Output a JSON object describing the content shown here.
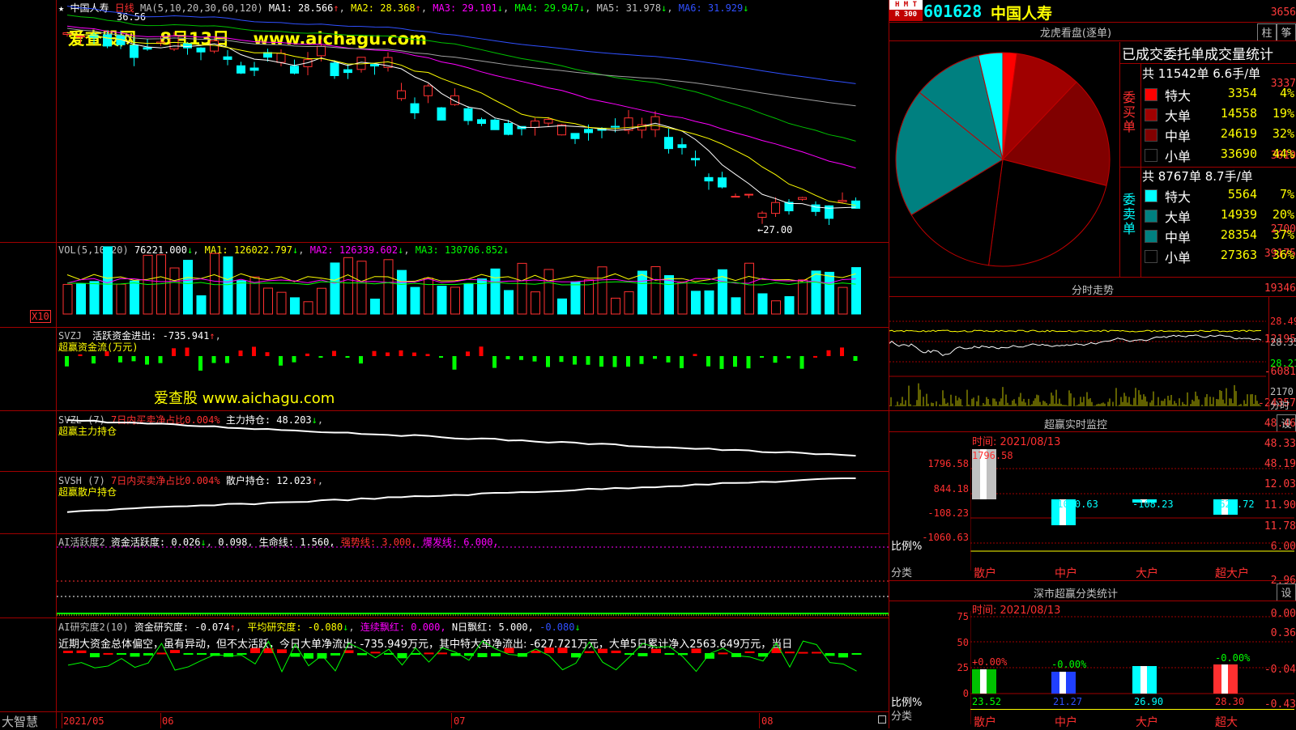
{
  "stock": {
    "code": "601628",
    "name": "中国人寿",
    "tag_lines": [
      "H M T",
      "R 300"
    ]
  },
  "watermark": {
    "site_name": "爱查股网",
    "date": "8月13日",
    "url": "www.aichagu.com",
    "sub": "爱查股 www.aichagu.com"
  },
  "main_chart": {
    "title_star": "★",
    "name": "中国人寿",
    "period": "日线",
    "ma_label": "MA(5,10,20,30,60,120)",
    "ma1": "MA1: 28.566",
    "ma2": "MA2: 28.368",
    "ma3": "MA3: 29.101",
    "ma4": "MA4: 29.947",
    "ma5": "MA5: 31.978",
    "ma6": "MA6: 31.929",
    "y_ticks": [
      "3656",
      "3337",
      "3019",
      "2700"
    ],
    "high_mark": "36.56",
    "low_mark": "←27.00",
    "chart_data": {
      "type": "line",
      "title": "中国人寿 日线",
      "y_ticks": [
        36.56,
        33.37,
        30.19,
        27.0
      ],
      "note": "candlestick price chart with moving averages"
    }
  },
  "vol_panel": {
    "label": "VOL(5,10,20)",
    "value": "76221.000",
    "ma1": "MA1: 126022.797",
    "ma2": "MA2: 126339.602",
    "ma3": "MA3: 130706.852",
    "y_ticks": [
      "39175",
      "19346"
    ],
    "unit": "X10"
  },
  "svzj_panel": {
    "label": "SVZJ",
    "title": "活跃资金进出: -735.941",
    "subtitle": "超赢资金流(万元)",
    "y_ticks": [
      "12195",
      "-6081",
      "-24357"
    ]
  },
  "svzl_panel": {
    "label": "SVZL (7)",
    "desc": "7日内买卖净占比0.004%",
    "value": "主力持仓: 48.203",
    "subtitle": "超赢主力持仓",
    "y_ticks": [
      "48.46",
      "48.33",
      "48.19"
    ]
  },
  "svsh_panel": {
    "label": "SVSH (7)",
    "desc": "7日内买卖净占比0.004%",
    "value": "散户持仓: 12.023",
    "subtitle": "超赢散户持仓",
    "y_ticks": [
      "12.03",
      "11.90",
      "11.78"
    ]
  },
  "ai_active_panel": {
    "label": "AI活跃度2",
    "v1": "资金活跃度: 0.026",
    "v2": "0.098",
    "v3": "生命线: 1.560,",
    "v4": "强势线: 3.000,",
    "v5": "爆发线: 6.000,",
    "y_ticks": [
      "6.00",
      "2.96",
      "0.00"
    ]
  },
  "ai_research_panel": {
    "label": "AI研究度2(10)",
    "v1": "资金研究度: -0.074",
    "v2": "平均研究度: -0.080",
    "v3": "连续飘红: 0.000,",
    "v4": "N日飘红: 5.000,",
    "v5": "-0.080",
    "comment": "近期大资金总体偏空，虽有异动，但不太活跃，今日大单净流出: -735.949万元，其中特大单净流出: -627.721万元，大单5日累计净入2563.649万元，当日",
    "y_ticks": [
      "0.36",
      "-0.04",
      "-0.43"
    ]
  },
  "date_axis": {
    "brand": "大智慧",
    "labels": [
      "2021/05",
      "06",
      "07",
      "08"
    ]
  },
  "dragon_tiger": {
    "title": "龙虎看盘(逐单)",
    "btn1": "柱",
    "btn2": "筝",
    "stats_title": "已成交委托单成交量统计",
    "buy_header": "共 11542单 6.6手/单",
    "buy_label": "委买单",
    "sell_header": "共 8767单 8.7手/单",
    "sell_label": "委卖单",
    "buy_rows": [
      {
        "name": "特大",
        "value": "3354",
        "pct": "4%",
        "color": "#ff0000"
      },
      {
        "name": "大单",
        "value": "14558",
        "pct": "19%",
        "color": "#a00000"
      },
      {
        "name": "中单",
        "value": "24619",
        "pct": "32%",
        "color": "#800000"
      },
      {
        "name": "小单",
        "value": "33690",
        "pct": "44%",
        "color": "#000000"
      }
    ],
    "sell_rows": [
      {
        "name": "特大",
        "value": "5564",
        "pct": "7%",
        "color": "#00ffff"
      },
      {
        "name": "大单",
        "value": "14939",
        "pct": "20%",
        "color": "#008080"
      },
      {
        "name": "中单",
        "value": "28354",
        "pct": "37%",
        "color": "#008080"
      },
      {
        "name": "小单",
        "value": "27363",
        "pct": "36%",
        "color": "#000000"
      }
    ]
  },
  "intraday": {
    "title": "分时走势",
    "prices": [
      "28.49",
      "28.35",
      "28.21"
    ],
    "vol": "2170",
    "vol_label": "分时"
  },
  "monitor": {
    "title": "超赢实时监控",
    "btn": "设",
    "time": "时间: 2021/08/13",
    "y_ticks": [
      "1796.58",
      "844.18",
      "-108.23",
      "-1060.63"
    ],
    "bar_labels": [
      "1796.58",
      "-1060.63",
      "-108.23",
      "-627.72"
    ],
    "ratio_label": "比例%",
    "category_label": "分类",
    "categories": [
      "散户",
      "中户",
      "大户",
      "超大户"
    ]
  },
  "sz_stats": {
    "title": "深市超赢分类统计",
    "btn": "设",
    "time": "时间: 2021/08/13",
    "y_ticks": [
      "75",
      "50",
      "25",
      "0"
    ],
    "top_labels": [
      "+0.00%",
      "-0.00%",
      "-0.00%"
    ],
    "bottom_labels": [
      "23.52",
      "21.27",
      "26.90",
      "28.30"
    ],
    "ratio_label": "比例%",
    "category_label": "分类",
    "categories": [
      "散户",
      "中户",
      "大户",
      "超大"
    ]
  }
}
